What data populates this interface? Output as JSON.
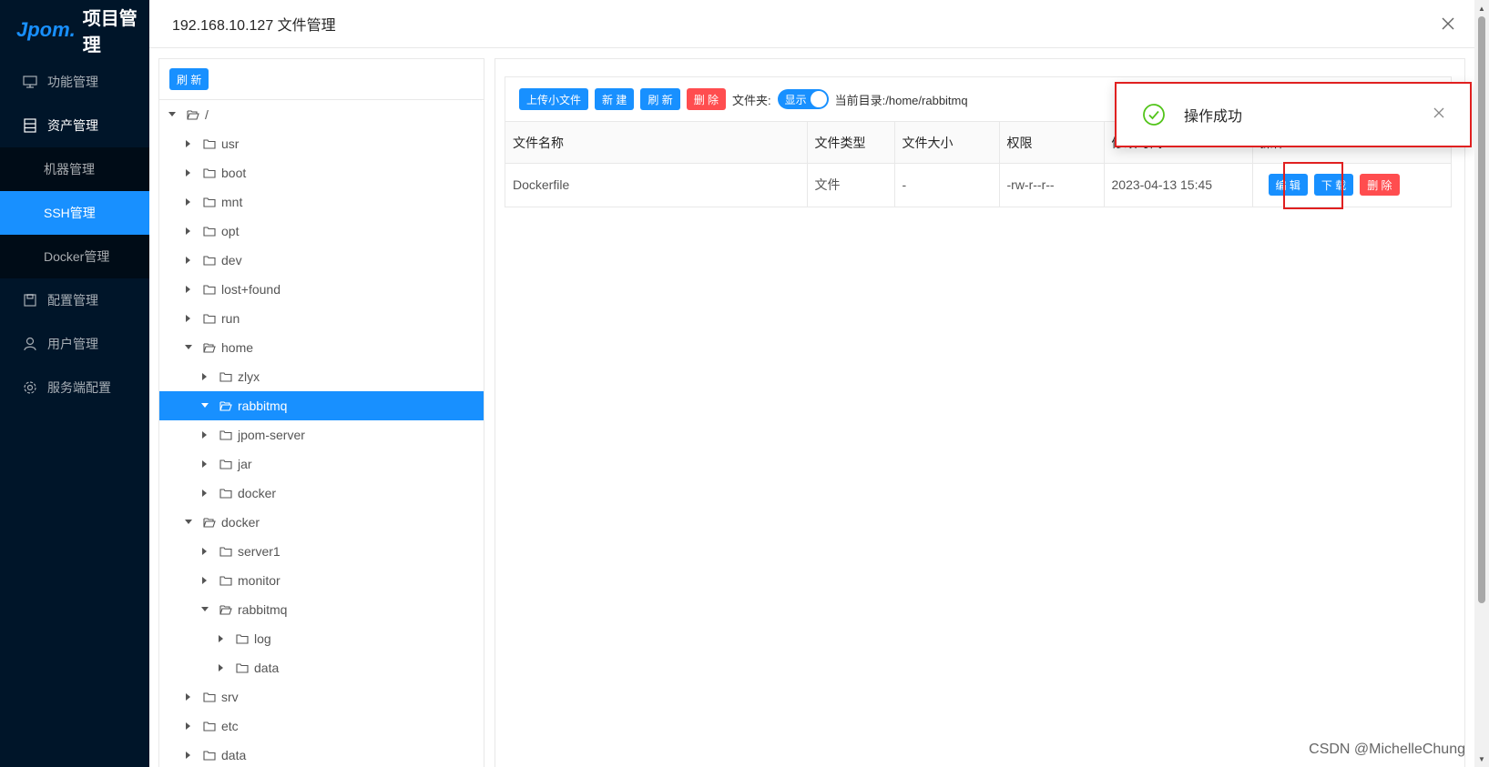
{
  "sidebar": {
    "logo_mark": "Jpom.",
    "logo_text": "项目管理",
    "items": [
      {
        "label": "功能管理",
        "icon": "monitor-icon"
      },
      {
        "label": "资产管理",
        "icon": "database-icon"
      },
      {
        "label": "机器管理"
      },
      {
        "label": "SSH管理"
      },
      {
        "label": "Docker管理"
      },
      {
        "label": "配置管理",
        "icon": "save-icon"
      },
      {
        "label": "用户管理",
        "icon": "user-icon"
      },
      {
        "label": "服务端配置",
        "icon": "gear-icon"
      }
    ]
  },
  "modal": {
    "title": "192.168.10.127 文件管理"
  },
  "tree": {
    "refresh_label": "刷 新",
    "nodes": [
      {
        "label": "/",
        "level": 0,
        "expanded": true
      },
      {
        "label": "usr",
        "level": 1
      },
      {
        "label": "boot",
        "level": 1
      },
      {
        "label": "mnt",
        "level": 1
      },
      {
        "label": "opt",
        "level": 1
      },
      {
        "label": "dev",
        "level": 1
      },
      {
        "label": "lost+found",
        "level": 1
      },
      {
        "label": "run",
        "level": 1
      },
      {
        "label": "home",
        "level": 1,
        "expanded": true
      },
      {
        "label": "zlyx",
        "level": 2
      },
      {
        "label": "rabbitmq",
        "level": 2,
        "expanded": true,
        "selected": true
      },
      {
        "label": "jpom-server",
        "level": 2
      },
      {
        "label": "jar",
        "level": 2
      },
      {
        "label": "docker",
        "level": 2
      },
      {
        "label": "docker",
        "level": 1,
        "expanded": true
      },
      {
        "label": "server1",
        "level": 2
      },
      {
        "label": "monitor",
        "level": 2
      },
      {
        "label": "rabbitmq",
        "level": 2,
        "expanded": true
      },
      {
        "label": "log",
        "level": 3
      },
      {
        "label": "data",
        "level": 3
      },
      {
        "label": "srv",
        "level": 1
      },
      {
        "label": "etc",
        "level": 1
      },
      {
        "label": "data",
        "level": 1
      }
    ]
  },
  "files": {
    "upload_label": "上传小文件",
    "new_label": "新 建",
    "refresh_label": "刷 新",
    "delete_label": "删 除",
    "folder_label": "文件夹:",
    "toggle_label": "显示",
    "current_dir": "当前目录:/home/rabbitmq",
    "columns": [
      "文件名称",
      "文件类型",
      "文件大小",
      "权限",
      "修改时间",
      "操作"
    ],
    "rows": [
      {
        "name": "Dockerfile",
        "type": "文件",
        "size": "-",
        "perm": "-rw-r--r--",
        "mtime": "2023-04-13 15:45"
      }
    ],
    "edit_label": "编 辑",
    "download_label": "下 载",
    "row_delete_label": "删 除"
  },
  "notification": {
    "message": "操作成功"
  },
  "watermark": "CSDN @MichelleChung"
}
